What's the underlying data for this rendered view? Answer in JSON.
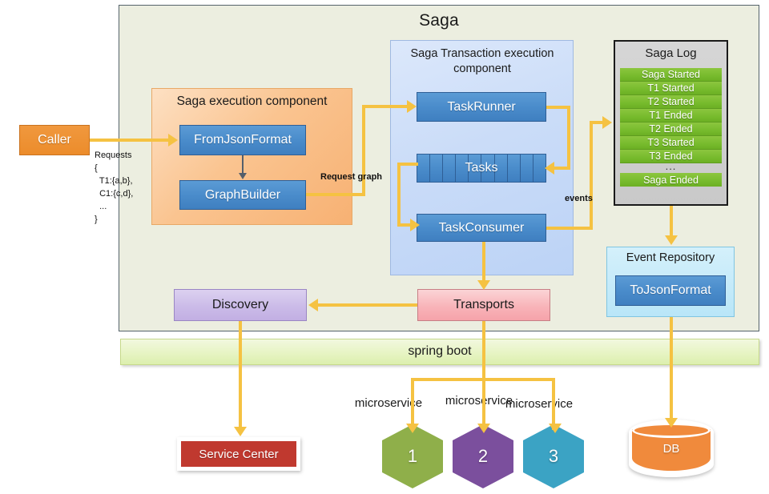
{
  "diagram": {
    "title": "Saga",
    "platform_band": {
      "label": "spring boot"
    }
  },
  "external": {
    "caller": {
      "label": "Caller"
    },
    "requests_note": "Requests\n{\n  T1:{a,b},\n  C1:{c,d},\n  ...\n}",
    "service_center": {
      "label": "Service Center"
    },
    "database": {
      "label": "DB"
    }
  },
  "saga_execution_component": {
    "title": "Saga execution component",
    "boxes": [
      {
        "label": "FromJsonFormat"
      },
      {
        "label": "GraphBuilder"
      }
    ]
  },
  "saga_transaction_component": {
    "title": "Saga Transaction execution component",
    "title_line1": "Saga Transaction execution",
    "title_line2": "component",
    "boxes": [
      {
        "label": "TaskRunner"
      },
      {
        "label": "Tasks",
        "cells": 10
      },
      {
        "label": "TaskConsumer"
      }
    ]
  },
  "saga_log": {
    "title": "Saga Log",
    "entries": [
      "Saga Started",
      "T1 Started",
      "T2 Started",
      "T1 Ended",
      "T2 Ended",
      "T3 Started",
      "T3 Ended"
    ],
    "ellipsis": "...",
    "final_entry": "Saga Ended"
  },
  "event_repository": {
    "title": "Event Repository",
    "box": {
      "label": "ToJsonFormat"
    }
  },
  "infrastructure": {
    "discovery": {
      "label": "Discovery"
    },
    "transports": {
      "label": "Transports"
    }
  },
  "microservices": [
    {
      "caption": "microservice",
      "number": "1",
      "color": "#8faf4a"
    },
    {
      "caption": "microservice",
      "number": "2",
      "color": "#7b4f9d"
    },
    {
      "caption": "microservice",
      "number": "3",
      "color": "#3ba3c4"
    }
  ],
  "edge_labels": {
    "request_graph": "Request graph",
    "events": "events"
  },
  "colors": {
    "accent_arrow": "#f5c242",
    "saga_container_bg": "#eceee0",
    "exec_component_bg": "#f7b173",
    "txn_component_bg": "#cadcf8",
    "component_box": "#4a8ccb",
    "log_entry": "#77bb2d",
    "log_panel": "#c9c9c9",
    "event_repo": "#b9e6f8",
    "caller": "#ec8c2b",
    "discovery": "#cbbbe8",
    "transports": "#f8b4b9",
    "service_center": "#c0392f",
    "db": "#f08a3c",
    "spring_boot": "#e7f4c4"
  }
}
